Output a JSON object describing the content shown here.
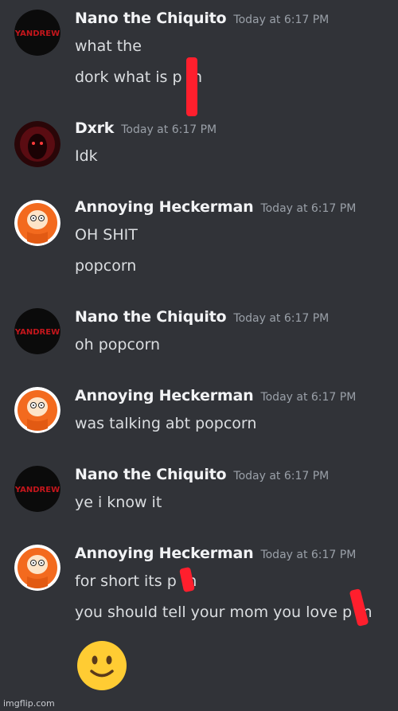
{
  "messages": [
    {
      "user": "Nano the Chiquito",
      "time": "Today at 6:17 PM",
      "avatar": "yandrew-avatar",
      "lines": [
        "what the",
        "dork what is p rn"
      ]
    },
    {
      "user": "Dxrk",
      "time": "Today at 6:17 PM",
      "avatar": "dxrk-avatar",
      "lines": [
        "Idk"
      ]
    },
    {
      "user": "Annoying Heckerman",
      "time": "Today at 6:17 PM",
      "avatar": "kenny-avatar",
      "lines": [
        "OH SHIT",
        "popcorn"
      ]
    },
    {
      "user": "Nano the Chiquito",
      "time": "Today at 6:17 PM",
      "avatar": "yandrew-avatar",
      "lines": [
        "oh popcorn"
      ]
    },
    {
      "user": "Annoying Heckerman",
      "time": "Today at 6:17 PM",
      "avatar": "kenny-avatar",
      "lines": [
        "was talking abt popcorn"
      ]
    },
    {
      "user": "Nano the Chiquito",
      "time": "Today at 6:17 PM",
      "avatar": "yandrew-avatar",
      "lines": [
        "ye i know it"
      ]
    },
    {
      "user": "Annoying Heckerman",
      "time": "Today at 6:17 PM",
      "avatar": "kenny-avatar",
      "lines": [
        "for short its p rn",
        "you should tell your mom you love p rn"
      ]
    }
  ],
  "avatar_text": "YANDREW",
  "emoji": "slightly-smiling-face",
  "watermark": "imgflip.com",
  "colors": {
    "background": "#313338",
    "username": "#f2f3f5",
    "timestamp": "#9aa0a8",
    "message": "#dbdee1",
    "censor": "#ff1f2d"
  }
}
